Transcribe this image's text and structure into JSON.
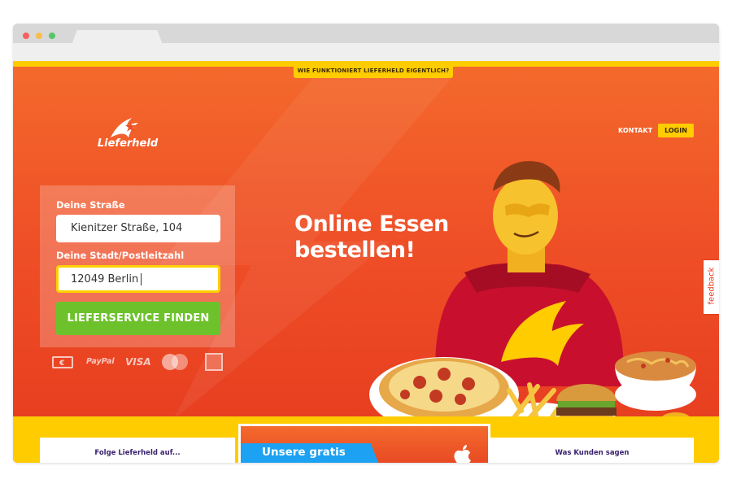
{
  "page": {
    "how_it_works": "WIE FUNKTIONIERT LIEFERHELD EIGENTLICH?",
    "brand": "Lieferheld"
  },
  "nav": {
    "contact": "KONTAKT",
    "login": "LOGIN"
  },
  "search": {
    "street_label": "Deine Straße",
    "street_value": "Kienitzer Straße, 104",
    "city_label": "Deine Stadt/Postleitzahl",
    "city_value": "12049 Berlin",
    "submit": "LIEFERSERVICE FINDEN"
  },
  "payments": {
    "paypal": "PayPal",
    "visa": "VISA"
  },
  "hero": {
    "headline_line1": "Online Essen",
    "headline_line2": "bestellen!"
  },
  "feedback": "feedback",
  "footer": {
    "follow": "Folge Lieferheld auf...",
    "promo": "Unsere gratis",
    "reviews": "Was Kunden sagen"
  },
  "colors": {
    "brand_orange": "#ef4f27",
    "accent_yellow": "#ffcc00",
    "cta_green": "#6dc22c",
    "promo_blue": "#1da1f2",
    "footer_text": "#3a2270"
  }
}
